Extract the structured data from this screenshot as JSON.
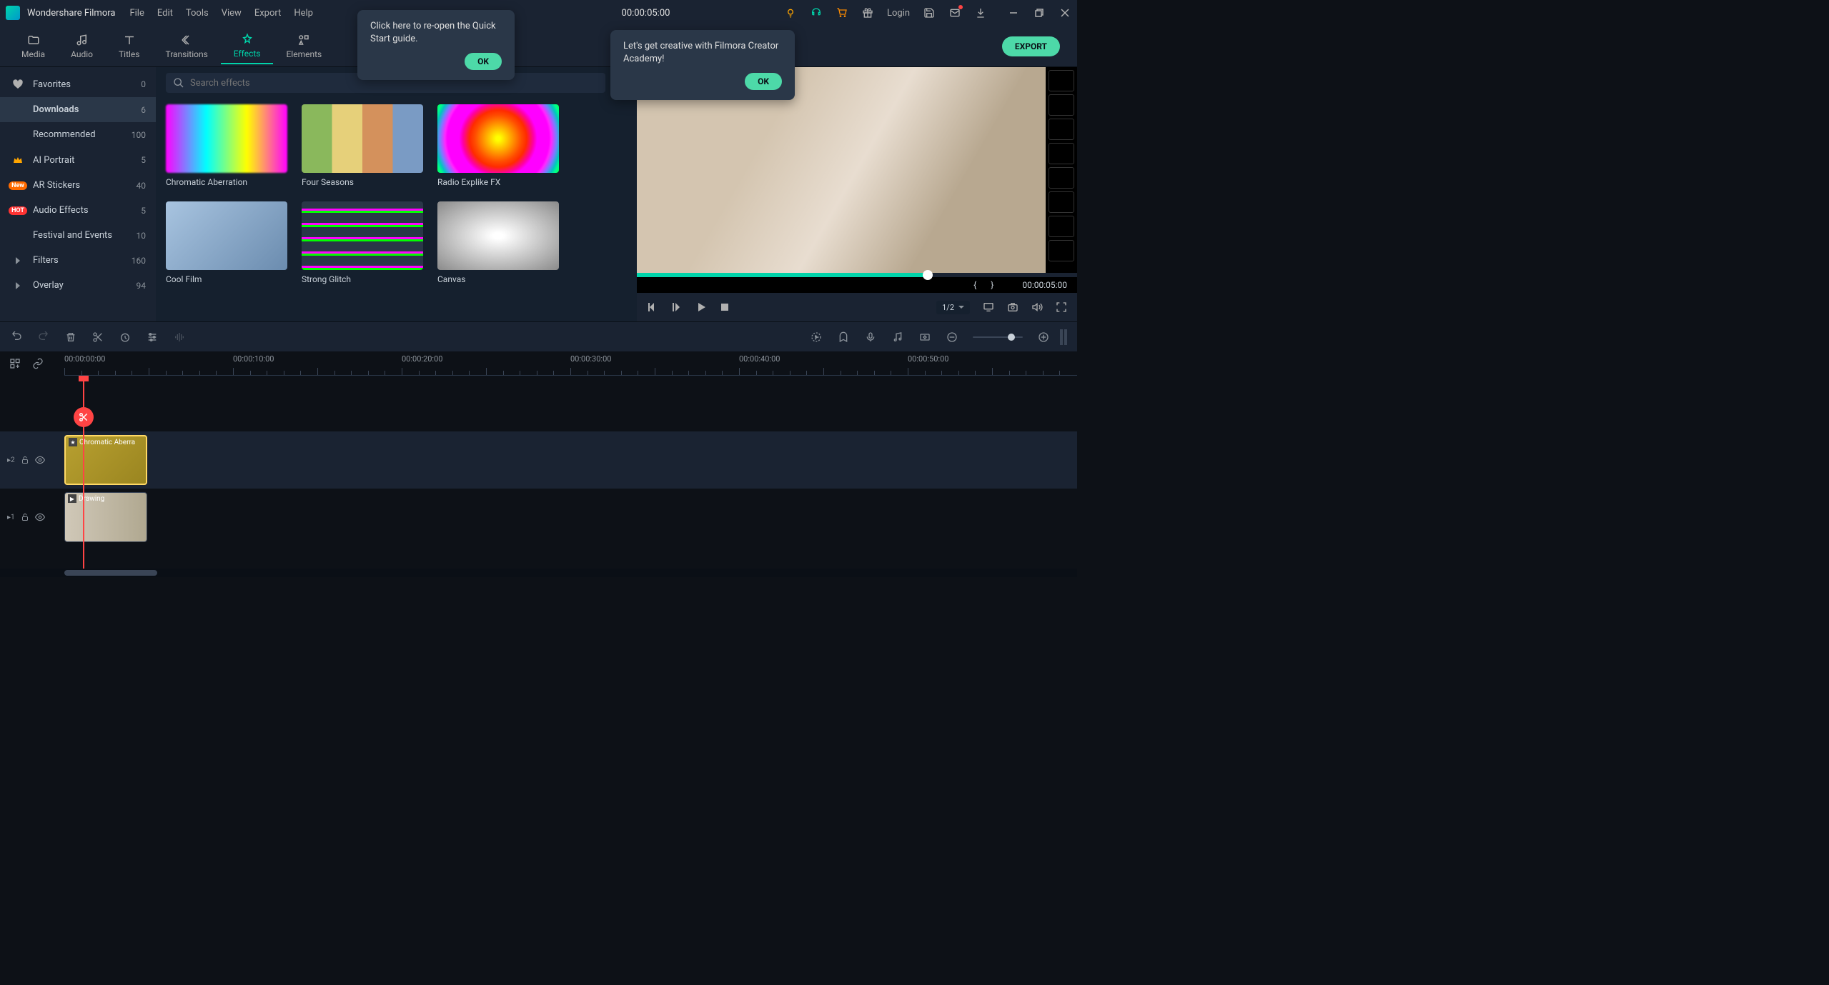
{
  "app": {
    "title": "Wondershare Filmora"
  },
  "menu": [
    "File",
    "Edit",
    "Tools",
    "View",
    "Export",
    "Help"
  ],
  "titlebar_time": "00:00:05:00",
  "login": "Login",
  "tabs": [
    {
      "label": "Media"
    },
    {
      "label": "Audio"
    },
    {
      "label": "Titles"
    },
    {
      "label": "Transitions"
    },
    {
      "label": "Effects",
      "active": true
    },
    {
      "label": "Elements"
    }
  ],
  "export_btn": "EXPORT",
  "sidebar": [
    {
      "icon": "heart",
      "label": "Favorites",
      "count": "0"
    },
    {
      "label": "Downloads",
      "count": "6",
      "active": true,
      "indent": true
    },
    {
      "label": "Recommended",
      "count": "100",
      "indent": true
    },
    {
      "icon": "crown",
      "label": "AI Portrait",
      "count": "5"
    },
    {
      "badge": "New",
      "label": "AR Stickers",
      "count": "40"
    },
    {
      "badge": "HOT",
      "label": "Audio Effects",
      "count": "5"
    },
    {
      "label": "Festival and Events",
      "count": "10",
      "indent": true
    },
    {
      "icon": "chevron",
      "label": "Filters",
      "count": "160"
    },
    {
      "icon": "chevron",
      "label": "Overlay",
      "count": "94"
    }
  ],
  "search": {
    "placeholder": "Search effects"
  },
  "effects": [
    {
      "name": "Chromatic Aberration",
      "cls": "thumb-chromatic"
    },
    {
      "name": "Four Seasons",
      "cls": "thumb-seasons"
    },
    {
      "name": "Radio Explike FX",
      "cls": "thumb-radio"
    },
    {
      "name": "Cool Film",
      "cls": "thumb-cool"
    },
    {
      "name": "Strong Glitch",
      "cls": "thumb-glitch"
    },
    {
      "name": "Canvas",
      "cls": "thumb-canvas"
    }
  ],
  "preview": {
    "time": "00:00:05:00",
    "ratio": "1/2",
    "braces_l": "{",
    "braces_r": "}"
  },
  "ruler": [
    "00:00:00:00",
    "00:00:10:00",
    "00:00:20:00",
    "00:00:30:00",
    "00:00:40:00",
    "00:00:50:00"
  ],
  "clips": {
    "effect": "Chromatic Aberra",
    "video": "Drawing"
  },
  "tracks": {
    "t2": "2",
    "t1": "1"
  },
  "tooltips": {
    "quick_start": "Click here to re-open the Quick Start guide.",
    "academy": "Let's get creative with Filmora Creator Academy!",
    "ok": "OK"
  }
}
